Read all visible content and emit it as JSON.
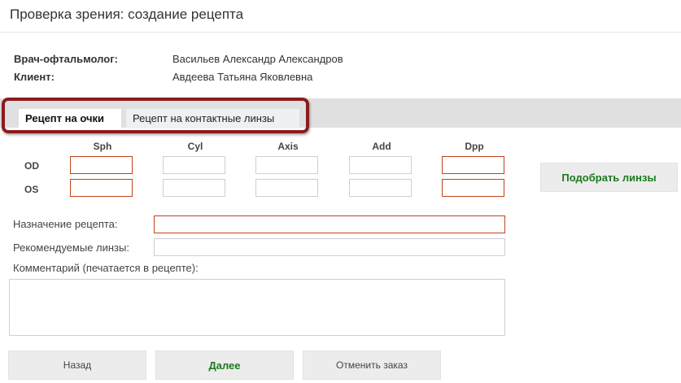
{
  "window": {
    "title": "Проверка зрения: создание рецепта"
  },
  "info": {
    "doctor_label": "Врач-офтальмолог:",
    "doctor_value": "Васильев Александр Александров",
    "client_label": "Клиент:",
    "client_value": "Авдеева Татьяна Яковлевна"
  },
  "tabs": [
    {
      "label": "Рецепт на очки",
      "active": true
    },
    {
      "label": "Рецепт на контактные линзы",
      "active": false
    }
  ],
  "table": {
    "columns": [
      "Sph",
      "Cyl",
      "Axis",
      "Add",
      "Dpp"
    ],
    "rows": [
      {
        "label": "OD",
        "values": [
          "",
          "",
          "",
          "",
          ""
        ]
      },
      {
        "label": "OS",
        "values": [
          "",
          "",
          "",
          "",
          ""
        ]
      }
    ],
    "required_columns": [
      "Sph",
      "Dpp"
    ]
  },
  "form": {
    "purpose_label": "Назначение рецепта:",
    "purpose_value": "",
    "lenses_label": "Рекомендуемые линзы:",
    "lenses_value": "",
    "comment_label": "Комментарий (печатается в рецепте):",
    "comment_value": ""
  },
  "buttons": {
    "pick_lenses": "Подобрать линзы",
    "back": "Назад",
    "next": "Далее",
    "cancel": "Отменить заказ"
  },
  "colors": {
    "required_border": "#c0441c",
    "highlight_frame": "#8b1c1c",
    "accent_green": "#1a7a1a"
  }
}
